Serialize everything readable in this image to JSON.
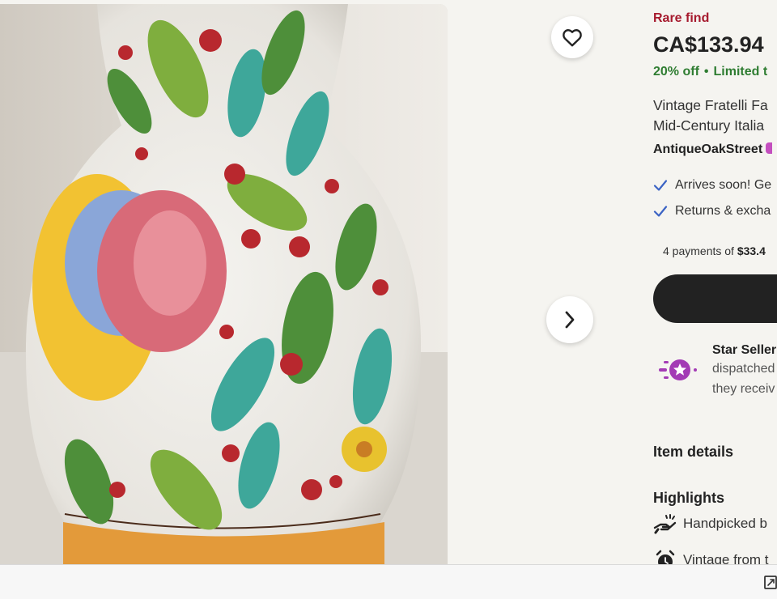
{
  "gallery": {
    "favorite_icon": "heart-outline-icon",
    "next_icon": "chevron-right-icon"
  },
  "listing": {
    "badge": "Rare find",
    "price": "CA$133.94",
    "discount": "20% off",
    "separator": "•",
    "sale_note": "Limited t",
    "title_line1": "Vintage Fratelli Fa",
    "title_line2": "Mid-Century Italia",
    "shop_name": "AntiqueOakStreet"
  },
  "perks": [
    {
      "icon": "check-icon",
      "text": "Arrives soon! Ge"
    },
    {
      "icon": "check-icon",
      "text": "Returns & excha"
    }
  ],
  "payments": {
    "prefix": "4 payments of",
    "amount": "$33.4"
  },
  "star_seller": {
    "icon": "star-seller-icon",
    "title": "Star Seller",
    "line1": "dispatched",
    "line2": "they receiv"
  },
  "sections": {
    "item_details": "Item details",
    "highlights": "Highlights"
  },
  "highlights": [
    {
      "icon": "handpicked-icon",
      "text": "Handpicked b"
    },
    {
      "icon": "alarm-clock-icon",
      "text": "Vintage from t"
    }
  ],
  "colors": {
    "rare": "#a61a2e",
    "discount": "#2f7d32",
    "check": "#3b63c4",
    "star_badge": "#a33bb5",
    "button": "#222222"
  }
}
